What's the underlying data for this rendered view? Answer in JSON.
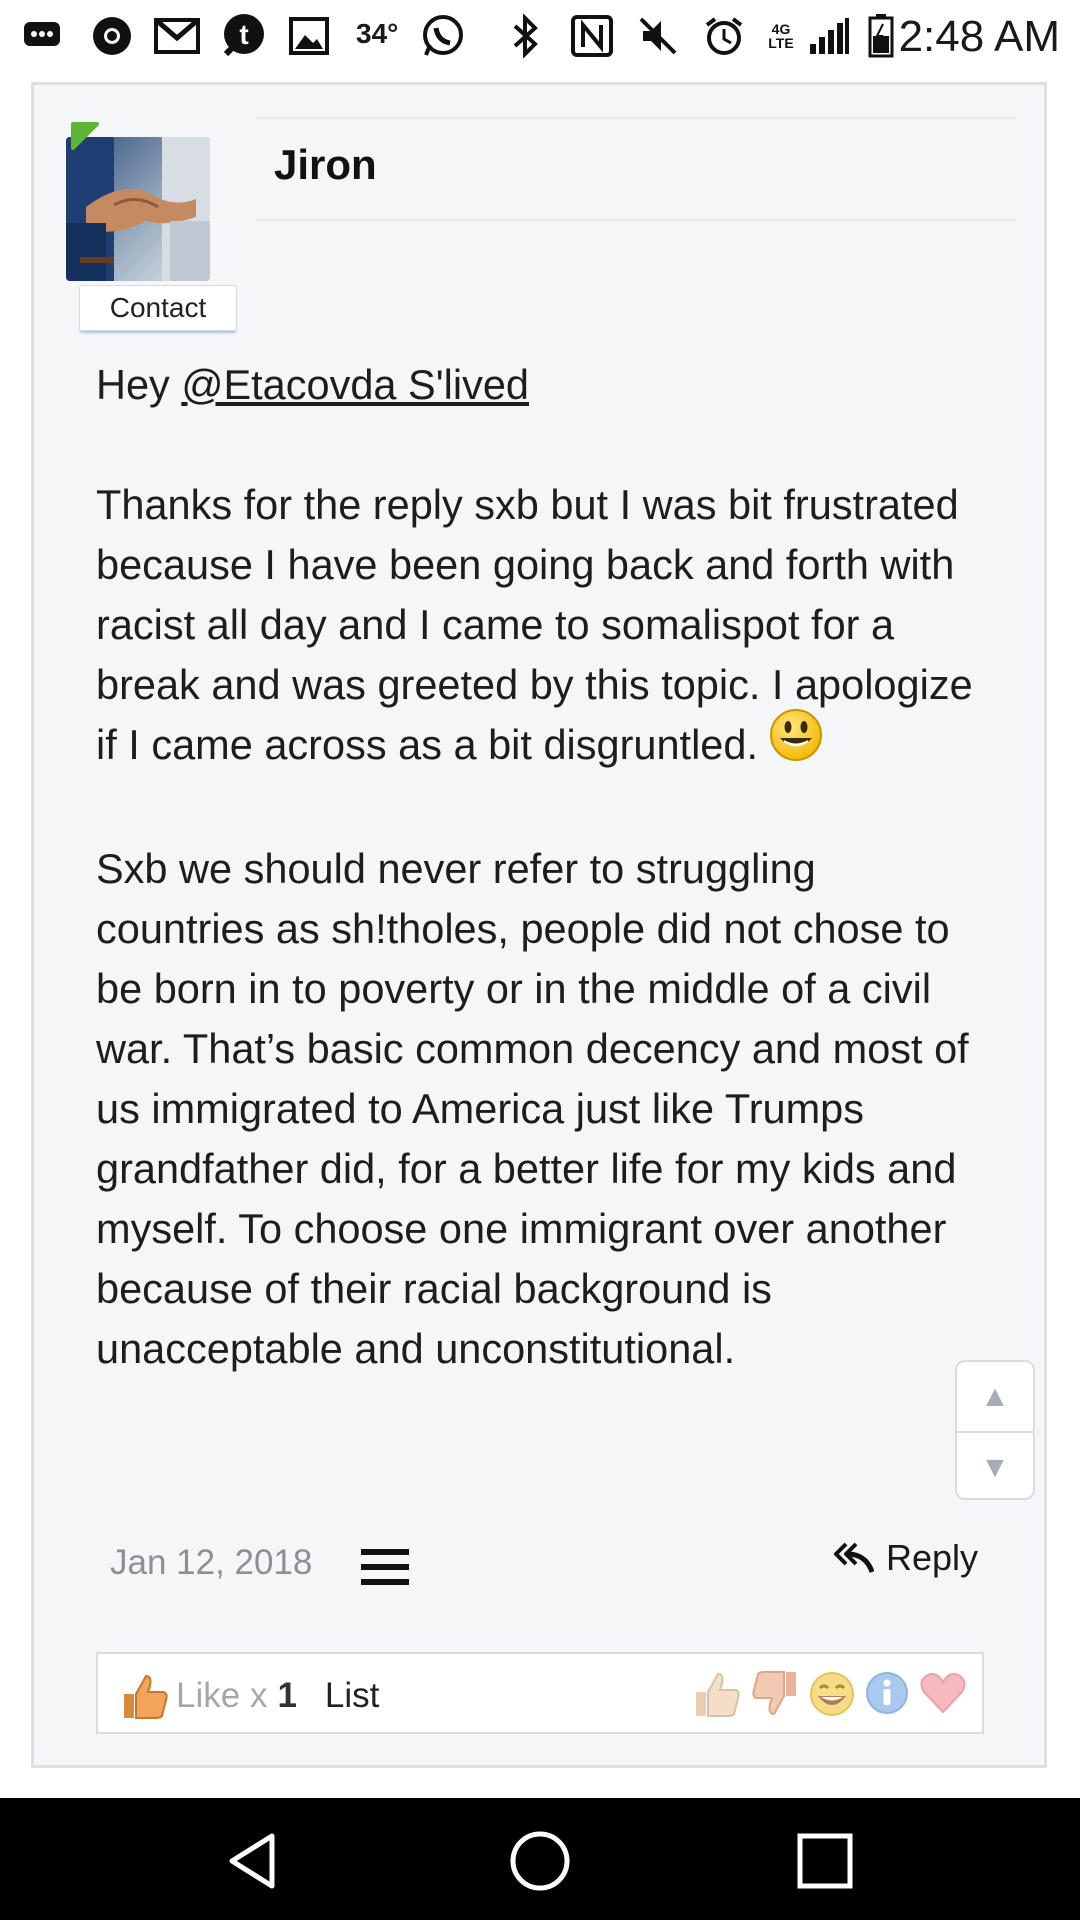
{
  "status_bar": {
    "temperature": "34°",
    "time": "2:48 AM",
    "network_label": "4G LTE",
    "icons": [
      "chat-icon",
      "chrome-icon",
      "gmail-icon",
      "tumblr-icon",
      "gallery-icon",
      "whatsapp-icon",
      "bluetooth-icon",
      "nfc-icon",
      "mute-icon",
      "alarm-icon",
      "signal-icon",
      "battery-icon"
    ]
  },
  "post": {
    "author": "Jiron",
    "contact_label": "Contact",
    "greeting_prefix": "Hey ",
    "mention": "@Etacovda S'lived",
    "paragraph_1": "Thanks for the reply sxb but I was bit frustrated because I have been going back and forth with racist all day and I came to somalispot for a break and was greeted by this topic. I apologize if I came across as a bit disgruntled.",
    "paragraph_1_emoji": "smiley-emoji",
    "paragraph_2": "Sxb we should never refer to struggling countries as sh!tholes, people did not chose to be born in to poverty or in the middle of a civil war. That’s basic common decency and most of us immigrated to America just like Trumps grandfather did, for a better life for my kids and myself. To choose one immigrant over another because of their racial background is unacceptable and unconstitutional.",
    "date": "Jan 12, 2018",
    "reply_label": "Reply",
    "like_label": "Like x",
    "like_count": "1",
    "list_label": "List",
    "reaction_icons": [
      "like-icon",
      "dislike-icon",
      "funny-icon",
      "informative-icon",
      "love-icon"
    ]
  },
  "scroll_control": {
    "up_arrow": "▲",
    "down_arrow": "▼"
  },
  "nav_bar": {
    "buttons": [
      "back",
      "home",
      "recents"
    ]
  },
  "colors": {
    "card_background": "#f5f6f8",
    "card_border": "#dcdfe4",
    "online_indicator": "#5fb336",
    "date_text": "#8b8f96"
  }
}
